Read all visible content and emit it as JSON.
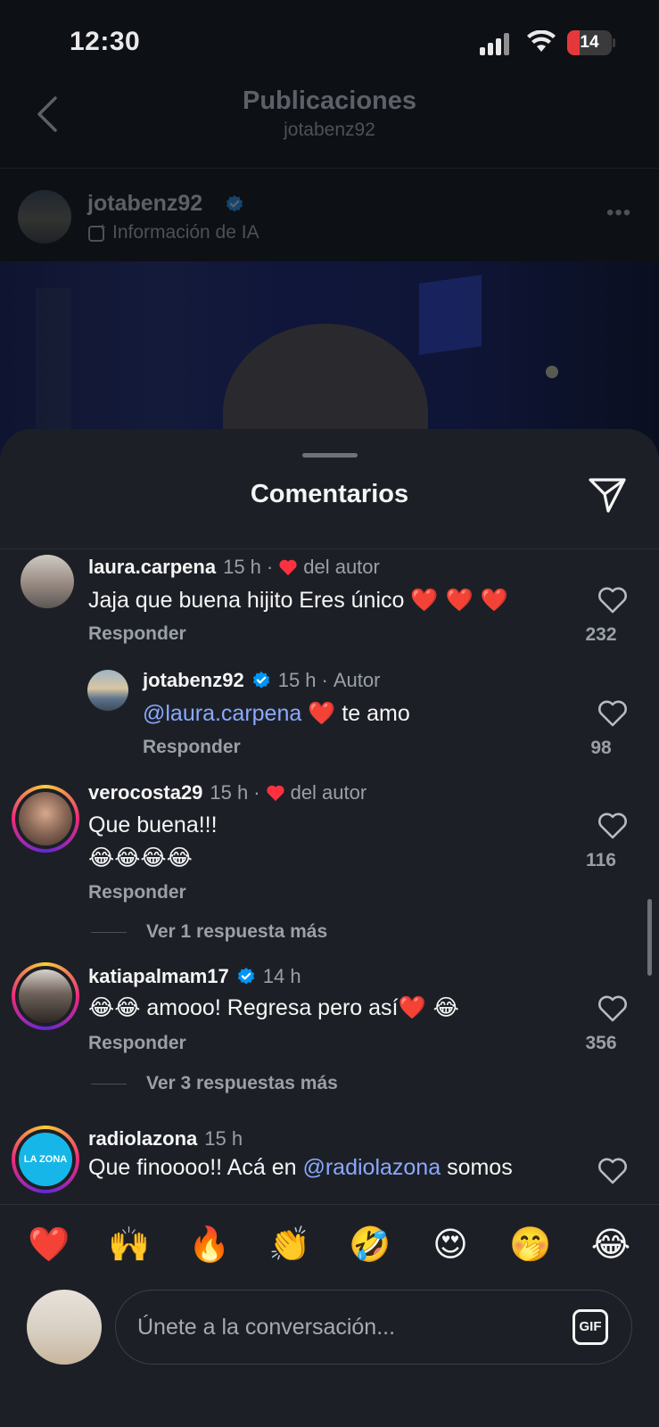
{
  "status_bar": {
    "time": "12:30",
    "battery": "14"
  },
  "header": {
    "title": "Publicaciones",
    "subtitle": "jotabenz92"
  },
  "post": {
    "username": "jotabenz92",
    "ai_info": "Información de IA",
    "more": "•••"
  },
  "sheet": {
    "title": "Comentarios"
  },
  "comments": [
    {
      "username": "laura.carpena",
      "time": "15 h",
      "liked_by_author": "del autor",
      "text": "Jaja que buena hijito Eres único",
      "emojis": "❤️ ❤️ ❤️",
      "reply": "Responder",
      "likes": "232"
    },
    {
      "username": "jotabenz92",
      "time": "15 h",
      "badge": "Autor",
      "mention": "@laura.carpena",
      "emojis": "❤️",
      "text": "te amo",
      "reply": "Responder",
      "likes": "98"
    },
    {
      "username": "verocosta29",
      "time": "15 h",
      "liked_by_author": "del autor",
      "text": "Que buena!!!",
      "emojis": "😂😂😂😂",
      "reply": "Responder",
      "likes": "116",
      "more_replies": "Ver 1 respuesta más"
    },
    {
      "username": "katiapalmam17",
      "time": "14 h",
      "emojis_before": "😂😂",
      "text": "amooo! Regresa pero así",
      "emojis_after": "❤️ 😂",
      "reply": "Responder",
      "likes": "356",
      "more_replies": "Ver 3 respuestas más"
    },
    {
      "username": "radiolazona",
      "time": "15 h",
      "text_before": "Que finoooo!! Acá en",
      "mention": "@radiolazona",
      "text_after": "somos",
      "avatar_text": "LA ZONA"
    }
  ],
  "reactions": [
    "❤️",
    "🙌",
    "🔥",
    "👏",
    "🤣",
    "😍",
    "🤭",
    "😂"
  ],
  "composer": {
    "placeholder": "Únete a la conversación...",
    "gif_label": "GIF"
  },
  "colors": {
    "sheet_bg": "#1c2026",
    "mention": "#8ba8ff",
    "heart": "#ff3040",
    "verified": "#0095f6"
  }
}
